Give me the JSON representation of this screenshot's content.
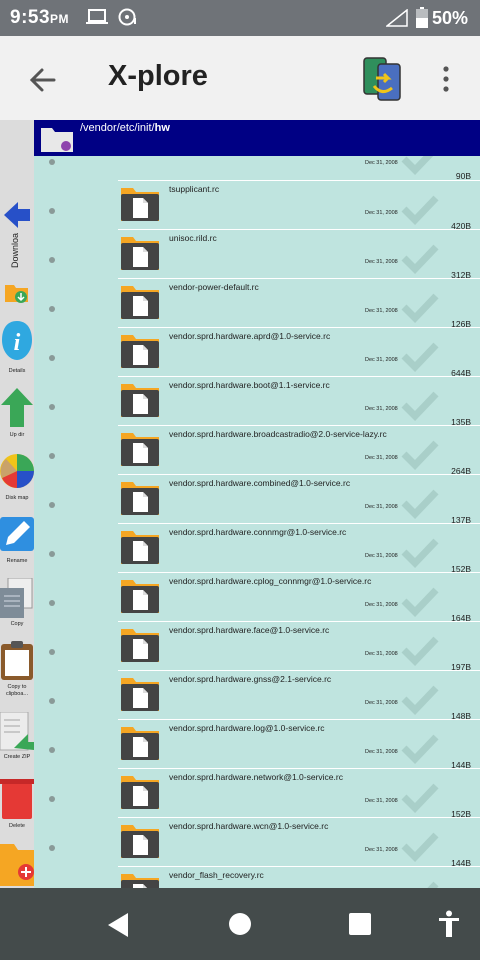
{
  "status": {
    "time": "9:53",
    "ampm": "PM",
    "battery": "50%"
  },
  "app": {
    "title": "X-plore"
  },
  "path": {
    "prefix": "/vendor/etc/init/",
    "current": "hw"
  },
  "tools": [
    {
      "label": "Downloa",
      "icon": "arrow-left-icon"
    },
    {
      "label": "",
      "icon": "download-folder-icon"
    },
    {
      "label": "Details",
      "icon": "info-icon"
    },
    {
      "label": "Up dir",
      "icon": "up-arrow-icon"
    },
    {
      "label": "Disk map",
      "icon": "pie-chart-icon"
    },
    {
      "label": "Rename",
      "icon": "pencil-icon"
    },
    {
      "label": "Copy",
      "icon": "copy-icon"
    },
    {
      "label": "Copy to clipboa...",
      "icon": "clipboard-icon"
    },
    {
      "label": "Create ZIP",
      "icon": "zip-icon"
    },
    {
      "label": "Delete",
      "icon": "trash-icon"
    },
    {
      "label": "",
      "icon": "new-folder-icon"
    }
  ],
  "files": {
    "partial_top": {
      "date": "Dec 31, 2008",
      "size": "90B"
    },
    "items": [
      {
        "name": "tsupplicant.rc",
        "date": "Dec 31, 2008",
        "size": "420B"
      },
      {
        "name": "unisoc.rild.rc",
        "date": "Dec 31, 2008",
        "size": "312B"
      },
      {
        "name": "vendor-power-default.rc",
        "date": "Dec 31, 2008",
        "size": "126B"
      },
      {
        "name": "vendor.sprd.hardware.aprd@1.0-service.rc",
        "date": "Dec 31, 2008",
        "size": "644B"
      },
      {
        "name": "vendor.sprd.hardware.boot@1.1-service.rc",
        "date": "Dec 31, 2008",
        "size": "135B"
      },
      {
        "name": "vendor.sprd.hardware.broadcastradio@2.0-service-lazy.rc",
        "date": "Dec 31, 2008",
        "size": "264B"
      },
      {
        "name": "vendor.sprd.hardware.combined@1.0-service.rc",
        "date": "Dec 31, 2008",
        "size": "137B"
      },
      {
        "name": "vendor.sprd.hardware.connmgr@1.0-service.rc",
        "date": "Dec 31, 2008",
        "size": "152B"
      },
      {
        "name": "vendor.sprd.hardware.cplog_connmgr@1.0-service.rc",
        "date": "Dec 31, 2008",
        "size": "164B"
      },
      {
        "name": "vendor.sprd.hardware.face@1.0-service.rc",
        "date": "Dec 31, 2008",
        "size": "197B"
      },
      {
        "name": "vendor.sprd.hardware.gnss@2.1-service.rc",
        "date": "Dec 31, 2008",
        "size": "148B"
      },
      {
        "name": "vendor.sprd.hardware.log@1.0-service.rc",
        "date": "Dec 31, 2008",
        "size": "144B"
      },
      {
        "name": "vendor.sprd.hardware.network@1.0-service.rc",
        "date": "Dec 31, 2008",
        "size": "152B"
      },
      {
        "name": "vendor.sprd.hardware.wcn@1.0-service.rc",
        "date": "Dec 31, 2008",
        "size": "144B"
      },
      {
        "name": "vendor_flash_recovery.rc",
        "date": "",
        "size": ""
      }
    ]
  },
  "colors": {
    "path_bar": "#000084",
    "list_bg": "#bfe4df",
    "toolbar_bg": "#dcdcdc",
    "nav_bg": "#444b4b"
  }
}
